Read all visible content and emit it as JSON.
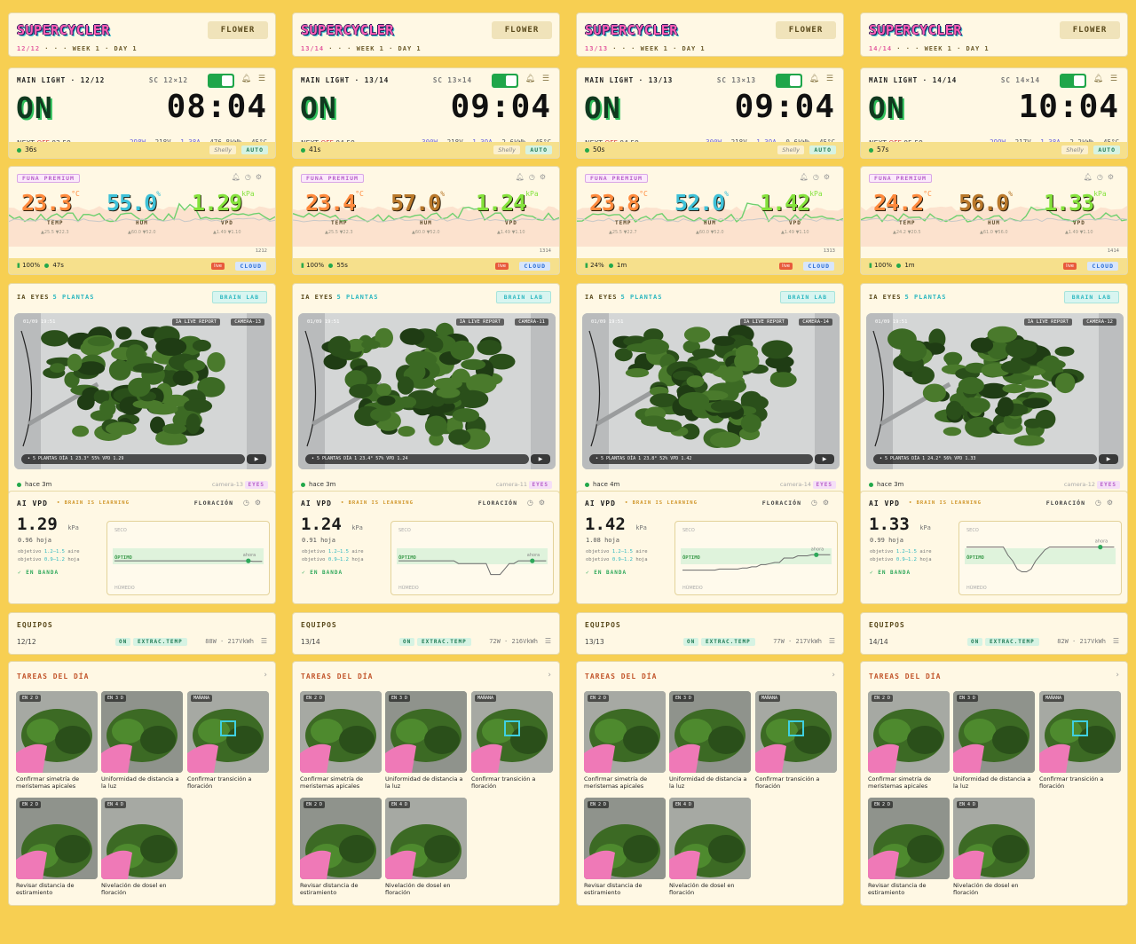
{
  "app": {
    "logo": "SUPERCYCLER",
    "phase_button": "FLOWER",
    "week": "WEEK 1",
    "day": "DAY 1"
  },
  "labels": {
    "next": "NEXT",
    "off": "OFF",
    "auto": "AUTO",
    "brand": "Shelly",
    "sensor_tag": "FUNA PREMIUM",
    "temp": "TEMP",
    "hum": "HUM",
    "vpd": "VPD",
    "cloud": "CLOUD",
    "live_tag": "live",
    "ia_eyes": "IA EYES",
    "plantas": "5 PLANTAS",
    "brain_lab": "BRAIN LAB",
    "ia_live_report": "IA LIVE REPORT",
    "cam_timestamp": "01/09 19:51",
    "eyes": "EYES",
    "ai_vpd": "AI VPD",
    "learning": "BRAIN IS LEARNING",
    "floracion": "FLORACIÓN",
    "kpa": "kPa",
    "hoja": "hoja",
    "objetivo": "objetivo",
    "aire": "aire",
    "obj_air": "1.2–1.5",
    "obj_leaf": "0.9–1.2",
    "en_banda": "✓ EN BANDA",
    "seco": "SECO",
    "optimo": "ÓPTIMO",
    "humedo": "HÚMEDO",
    "ahora": "ahora",
    "equipos": "EQUIPOS",
    "on": "ON",
    "extrac": "EXTRAC.TEMP",
    "tareas": "TAREAS DEL DÍA",
    "chevron": "›",
    "play": "▶"
  },
  "colors": {
    "temp": "#ff8a3d",
    "hum_blue": "#3ec1d8",
    "hum_brown": "#b9782a",
    "vpd": "#84e23c",
    "line_green": "#6fd06f",
    "line_grey": "#c8c8c8"
  },
  "columns": [
    {
      "cycle": "12/12",
      "sc": "SC 12×12",
      "time": "08:04",
      "next_off": "03:59",
      "m_w": "298",
      "m_v": "218",
      "m_a": "1.38",
      "m_kwh": "476.8",
      "m_t": "45",
      "uptime": "36s",
      "temp": "23.3",
      "hum": "55.0",
      "vpd": "1.29",
      "hum_color": "blue",
      "temp_range": "▲25.5 ▼22.3",
      "hum_range": "▲60.0 ▼52.0",
      "vpd_range": "▲1.49 ▼1.10",
      "serial": "1212",
      "batt": "100%",
      "age": "47s",
      "camera": "CAMERA-13",
      "camera_small": "camera-13",
      "cam_bar": "• 5 PLANTAS   DÍA 1   23.3°   55%   VPD 1.29",
      "cam_age": "hace 3m",
      "vpd_ai": "1.29",
      "leaf": "0.96",
      "eq_count": "12/12",
      "eq_watt": "88W · 217VkWh",
      "vpd_line": [
        0.55,
        0.55,
        0.55,
        0.55,
        0.55,
        0.55,
        0.55,
        0.55,
        0.55,
        0.55,
        0.55,
        0.55,
        0.55,
        0.55,
        0.55,
        0.55,
        0.55,
        0.55,
        0.55,
        0.55,
        0.55,
        0.55,
        0.55,
        0.55,
        0.55,
        0.55,
        0.55,
        0.55,
        0.55,
        0.55,
        0.56,
        0.56,
        0.56
      ],
      "task_labels": [
        "Confirmar simetría de meristemas apicales",
        "Uniformidad de distancia a la luz",
        "Confirmar transición a floración",
        "Revisar distancia de estiramiento",
        "Nivelación de dosel en floración"
      ],
      "task_badges": [
        "EN 2 D",
        "EN 3 D",
        "MAÑANA",
        "EN 2 D",
        "EN 4 D"
      ]
    },
    {
      "cycle": "13/14",
      "sc": "SC 13×14",
      "time": "09:04",
      "next_off": "04:59",
      "m_w": "300",
      "m_v": "218",
      "m_a": "1.39",
      "m_kwh": "2.6",
      "m_t": "45",
      "uptime": "41s",
      "temp": "23.4",
      "hum": "57.0",
      "vpd": "1.24",
      "hum_color": "brown",
      "temp_range": "▲25.5 ▼22.3",
      "hum_range": "▲60.0 ▼52.0",
      "vpd_range": "▲1.49 ▼1.10",
      "serial": "1314",
      "batt": "100%",
      "age": "55s",
      "camera": "CAMERA-11",
      "camera_small": "camera-11",
      "cam_bar": "• 5 PLANTAS   DÍA 1   23.4°   57%   VPD 1.24",
      "cam_age": "hace 3m",
      "vpd_ai": "1.24",
      "leaf": "0.91",
      "eq_count": "13/14",
      "eq_watt": "72W · 216VkWh",
      "vpd_line": [
        0.55,
        0.55,
        0.55,
        0.55,
        0.55,
        0.55,
        0.55,
        0.55,
        0.55,
        0.55,
        0.55,
        0.55,
        0.55,
        0.6,
        0.6,
        0.6,
        0.6,
        0.6,
        0.6,
        0.6,
        0.8,
        0.8,
        0.8,
        0.7,
        0.6,
        0.6,
        0.55,
        0.55,
        0.55,
        0.55,
        0.55,
        0.55,
        0.55
      ],
      "task_labels": [
        "Confirmar simetría de meristemas apicales",
        "Uniformidad de distancia a la luz",
        "Confirmar transición a floración",
        "Revisar distancia de estiramiento",
        "Nivelación de dosel en floración"
      ],
      "task_badges": [
        "EN 2 D",
        "EN 3 D",
        "MAÑANA",
        "EN 2 D",
        "EN 4 D"
      ]
    },
    {
      "cycle": "13/13",
      "sc": "SC 13×13",
      "time": "09:04",
      "next_off": "04:59",
      "m_w": "300",
      "m_v": "218",
      "m_a": "1.39",
      "m_kwh": "0.6",
      "m_t": "45",
      "uptime": "50s",
      "temp": "23.8",
      "hum": "52.0",
      "vpd": "1.42",
      "hum_color": "blue",
      "temp_range": "▲25.5 ▼22.7",
      "hum_range": "▲60.0 ▼52.0",
      "vpd_range": "▲1.49 ▼1.10",
      "serial": "1313",
      "batt": "24%",
      "age": "1m",
      "camera": "CAMERA-14",
      "camera_small": "camera-14",
      "cam_bar": "• 5 PLANTAS   DÍA 1   23.8°   52%   VPD 1.42",
      "cam_age": "hace 4m",
      "vpd_ai": "1.42",
      "leaf": "1.08",
      "eq_count": "13/13",
      "eq_watt": "77W · 217VkWh",
      "vpd_line": [
        0.72,
        0.72,
        0.72,
        0.72,
        0.72,
        0.72,
        0.72,
        0.72,
        0.7,
        0.7,
        0.7,
        0.7,
        0.7,
        0.68,
        0.68,
        0.66,
        0.66,
        0.62,
        0.62,
        0.6,
        0.58,
        0.58,
        0.5,
        0.5,
        0.5,
        0.46,
        0.46,
        0.46,
        0.44,
        0.44,
        0.44,
        0.44,
        0.44
      ],
      "task_labels": [
        "Confirmar simetría de meristemas apicales",
        "Uniformidad de distancia a la luz",
        "Confirmar transición a floración",
        "Revisar distancia de estiramiento",
        "Nivelación de dosel en floración"
      ],
      "task_badges": [
        "EN 2 D",
        "EN 3 D",
        "MAÑANA",
        "EN 2 D",
        "EN 4 D"
      ]
    },
    {
      "cycle": "14/14",
      "sc": "SC 14×14",
      "time": "10:04",
      "next_off": "05:59",
      "m_w": "299",
      "m_v": "217",
      "m_a": "1.38",
      "m_kwh": "2.2",
      "m_t": "45",
      "uptime": "57s",
      "temp": "24.2",
      "hum": "56.0",
      "vpd": "1.33",
      "hum_color": "brown",
      "temp_range": "▲24.2 ▼20.5",
      "hum_range": "▲61.0 ▼56.0",
      "vpd_range": "▲1.49 ▼1.10",
      "serial": "1414",
      "batt": "100%",
      "age": "1m",
      "camera": "CAMERA-12",
      "camera_small": "camera-12",
      "cam_bar": "• 5 PLANTAS   DÍA 1   24.2°   56%   VPD 1.33",
      "cam_age": "hace 3m",
      "vpd_ai": "1.33",
      "leaf": "0.99",
      "eq_count": "14/14",
      "eq_watt": "82W · 217VkWh",
      "vpd_line": [
        0.3,
        0.3,
        0.3,
        0.3,
        0.3,
        0.3,
        0.3,
        0.3,
        0.3,
        0.45,
        0.55,
        0.7,
        0.75,
        0.75,
        0.7,
        0.55,
        0.45,
        0.35,
        0.3,
        0.3,
        0.3,
        0.3,
        0.3,
        0.3,
        0.3,
        0.3,
        0.3,
        0.3,
        0.3,
        0.3,
        0.3,
        0.3,
        0.3
      ],
      "task_labels": [
        "Confirmar simetría de meristemas apicales",
        "Uniformidad de distancia a la luz",
        "Confirmar transición a floración",
        "Revisar distancia de estiramiento",
        "Nivelación de dosel en floración"
      ],
      "task_badges": [
        "EN 2 D",
        "EN 3 D",
        "MAÑANA",
        "EN 2 D",
        "EN 4 D"
      ]
    }
  ]
}
